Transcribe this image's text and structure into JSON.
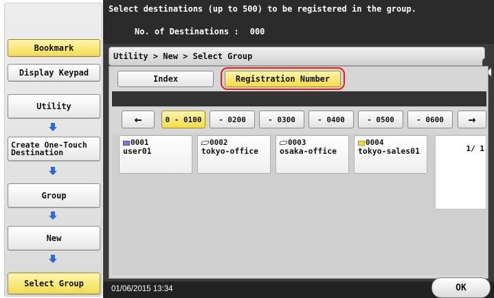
{
  "header": {
    "message": "Select destinations (up to 500) to be registered in the group.",
    "count_label": "No. of Destinations :",
    "count_value": "000"
  },
  "sidebar": {
    "bookmark": "Bookmark",
    "display_keypad": "Display Keypad",
    "steps": [
      {
        "label": "Utility"
      },
      {
        "label": "Create One-Touch Destination"
      },
      {
        "label": "Group"
      },
      {
        "label": "New"
      },
      {
        "label": "Select Group"
      }
    ]
  },
  "breadcrumb": "Utility > New > Select Group",
  "tabs": [
    {
      "label": "Index",
      "selected": false
    },
    {
      "label": "Registration Number",
      "selected": true
    }
  ],
  "range": {
    "prev_icon": "left-arrow",
    "next_icon": "right-arrow",
    "prev_glyph": "←",
    "next_glyph": "→",
    "ranges": [
      "0 - 0100",
      "- 0200",
      "- 0300",
      "- 0400",
      "- 0500",
      "- 0600"
    ],
    "selected_index": 0
  },
  "destinations": [
    {
      "number": "0001",
      "name": "user01",
      "icon": "box-icon"
    },
    {
      "number": "0002",
      "name": "tokyo-office",
      "icon": "folder-icon"
    },
    {
      "number": "0003",
      "name": "osaka-office",
      "icon": "folder-icon"
    },
    {
      "number": "0004",
      "name": "tokyo-sales01",
      "icon": "email-icon"
    }
  ],
  "pager": "1/  1",
  "footer": {
    "datetime": "01/06/2015  13:34",
    "ok_label": "OK"
  },
  "colors": {
    "highlight": "#f3dc4a",
    "focus_ring": "#d9211f",
    "step_arrow": "#2e6ad6"
  }
}
